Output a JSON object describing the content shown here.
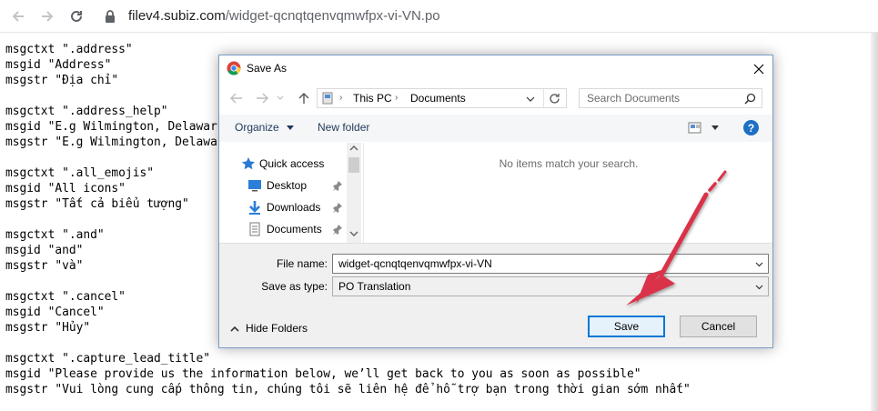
{
  "browser": {
    "url_host": "filev4.subiz.com",
    "url_path": "/widget-qcnqtqenvqmwfpx-vi-VN.po"
  },
  "page_text": "msgctxt \".address\"\nmsgid \"Address\"\nmsgstr \"Địa chỉ\"\n\nmsgctxt \".address_help\"\nmsgid \"E.g Wilmington, Delawar\nmsgstr \"E.g Wilmington, Delawa\n\nmsgctxt \".all_emojis\"\nmsgid \"All icons\"\nmsgstr \"Tất cả biểu tượng\"\n\nmsgctxt \".and\"\nmsgid \"and\"\nmsgstr \"và\"\n\nmsgctxt \".cancel\"\nmsgid \"Cancel\"\nmsgstr \"Hủy\"\n\nmsgctxt \".capture_lead_title\"\nmsgid \"Please provide us the information below, we’ll get back to you as soon as possible\"\nmsgstr \"Vui lòng cung cấp thông tin, chúng tôi sẽ liên hệ để hỗ trợ bạn trong thời gian sớm nhất\"",
  "dialog": {
    "title": "Save As",
    "breadcrumb": [
      "This PC",
      "Documents"
    ],
    "search_placeholder": "Search Documents",
    "toolbar": {
      "organize": "Organize",
      "new_folder": "New folder",
      "help": "?"
    },
    "nav_items": [
      {
        "label": "Quick access",
        "icon": "star-icon"
      },
      {
        "label": "Desktop",
        "icon": "desktop-icon",
        "pinned": true
      },
      {
        "label": "Downloads",
        "icon": "download-icon",
        "pinned": true
      },
      {
        "label": "Documents",
        "icon": "document-icon",
        "pinned": true
      }
    ],
    "empty_message": "No items match your search.",
    "file_name_label": "File name:",
    "file_name_value": "widget-qcnqtqenvqmwfpx-vi-VN",
    "save_type_label": "Save as type:",
    "save_type_value": "PO Translation",
    "hide_folders": "Hide Folders",
    "save_button": "Save",
    "cancel_button": "Cancel"
  },
  "colors": {
    "accent_blue": "#0078d7",
    "annotation_red": "#d9334a"
  }
}
